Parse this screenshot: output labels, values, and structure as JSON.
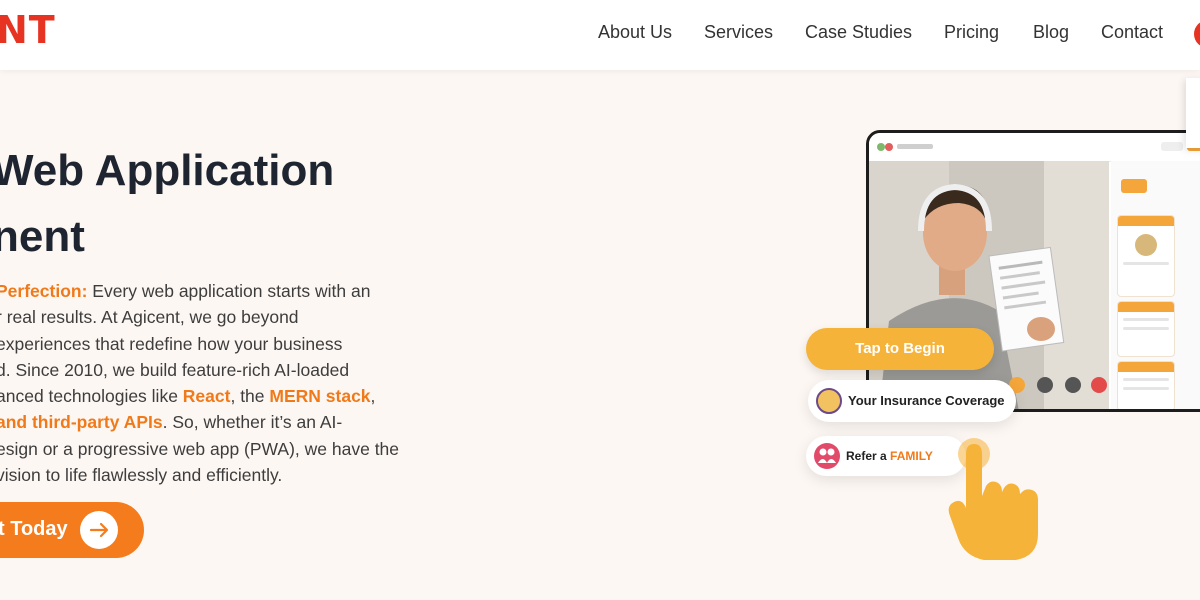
{
  "header": {
    "logo_text": "NT",
    "nav": [
      {
        "label": "About Us"
      },
      {
        "label": "Services"
      },
      {
        "label": "Case Studies"
      },
      {
        "label": "Pricing"
      },
      {
        "label": "Blog"
      },
      {
        "label": "Contact"
      }
    ]
  },
  "hero": {
    "title_lines": [
      "Web Application",
      "nent"
    ],
    "paragraph_lines": [
      {
        "hl": "Perfection:",
        "rest": " Every web application starts with an"
      },
      {
        "text": "r real results. At Agicent, we go beyond"
      },
      {
        "text": "experiences that redefine how your business"
      },
      {
        "text": "d. Since 2010, we build feature-rich AI-loaded"
      },
      {
        "pre": "anced technologies like ",
        "hl1": "React",
        "mid": ", the ",
        "hl2": "MERN stack",
        "post": ","
      },
      {
        "hl": "and third-party APIs",
        "rest": ". So, whether it’s an AI-"
      },
      {
        "text": "esign or a progressive web app (PWA), we have the"
      },
      {
        "text": "vision to life flawlessly and efficiently."
      }
    ],
    "cta_label": "t Today"
  },
  "mockup": {
    "tap_label": "Tap to Begin",
    "insurance_label": "Your Insurance Coverage",
    "refer_prefix": "Refer a ",
    "refer_highlight": "FAMILY"
  },
  "colors": {
    "accent": "#f47c1c",
    "brand_red": "#e63322",
    "pill_yellow": "#f6b33a",
    "background": "#fdf7f3"
  }
}
